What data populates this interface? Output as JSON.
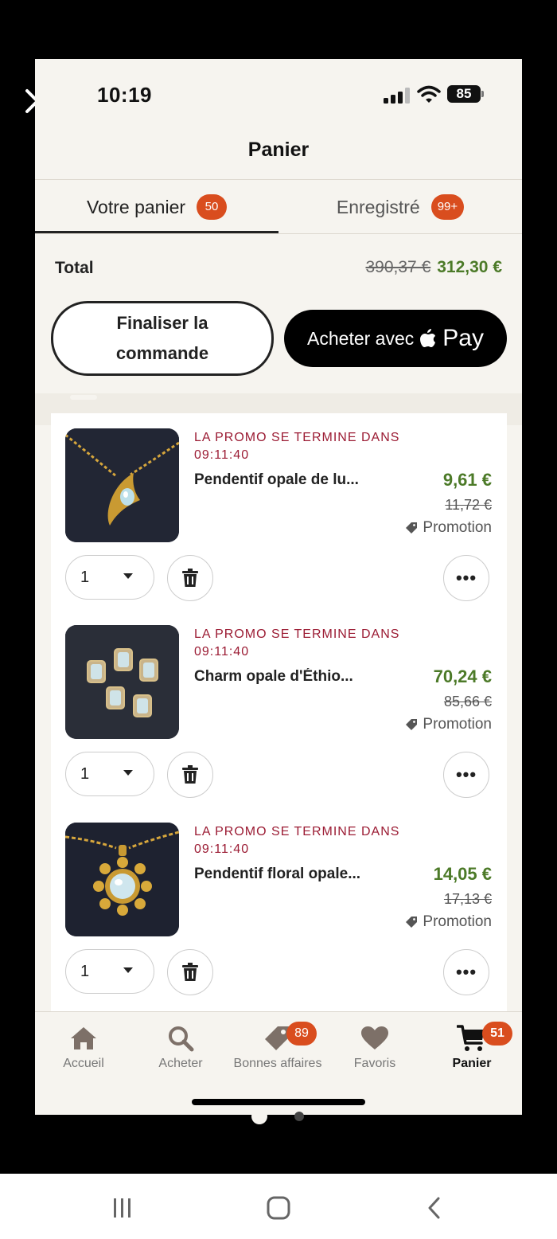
{
  "status": {
    "time": "10:19",
    "battery": "85"
  },
  "header": {
    "title": "Panier"
  },
  "tabs": [
    {
      "label": "Votre panier",
      "badge": "50"
    },
    {
      "label": "Enregistré",
      "badge": "99+"
    }
  ],
  "summary": {
    "total_label": "Total",
    "original_total": "390,37 €",
    "discounted_total": "312,30 €"
  },
  "actions": {
    "checkout_line1": "Finaliser la",
    "checkout_line2": "commande",
    "applepay_prefix": "Acheter avec",
    "applepay_brand": "Pay"
  },
  "items": [
    {
      "promo_line1": "LA PROMO SE TERMINE DANS",
      "promo_line2": "09:11:40",
      "title": "Pendentif opale de lu...",
      "price": "9,61 €",
      "old_price": "11,72 €",
      "promotion": "Promotion",
      "quantity": "1"
    },
    {
      "promo_line1": "LA PROMO SE TERMINE DANS",
      "promo_line2": "09:11:40",
      "title": "Charm opale d'Éthio...",
      "price": "70,24 €",
      "old_price": "85,66 €",
      "promotion": "Promotion",
      "quantity": "1"
    },
    {
      "promo_line1": "LA PROMO SE TERMINE DANS",
      "promo_line2": "09:11:40",
      "title": "Pendentif floral opale...",
      "price": "14,05 €",
      "old_price": "17,13 €",
      "promotion": "Promotion",
      "quantity": "1"
    }
  ],
  "more_label": "•••",
  "nav": [
    {
      "label": "Accueil",
      "icon": "home-icon"
    },
    {
      "label": "Acheter",
      "icon": "search-icon"
    },
    {
      "label": "Bonnes affaires",
      "icon": "tag-icon",
      "badge": "89"
    },
    {
      "label": "Favoris",
      "icon": "heart-icon"
    },
    {
      "label": "Panier",
      "icon": "cart-icon",
      "badge": "51"
    }
  ],
  "colors": {
    "accent": "#d94d1e",
    "price_green": "#4c7a28",
    "promo_red": "#9b1b33",
    "background": "#f6f4ef"
  }
}
